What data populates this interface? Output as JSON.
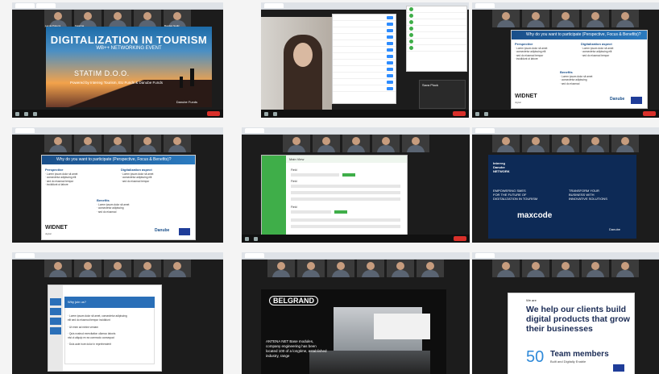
{
  "tile1": {
    "participants": [
      "Lamia Pokorni",
      "Katarina",
      "",
      "",
      "Bogdan Sudić"
    ],
    "slide": {
      "title": "DIGITALIZATION IN TOURISM",
      "subtitle": "WB++ NETWORKING EVENT",
      "company": "STATIM D.O.O.",
      "powered_by": "Powered by Interreg Tourism, EU Funds & Danube Funds",
      "logo": "Danube Funds"
    }
  },
  "tile2": {
    "menu_items": [
      "",
      "",
      "",
      "",
      "",
      "",
      "",
      "",
      "",
      "",
      "",
      ""
    ],
    "chat_items": [
      "",
      "",
      "",
      "",
      "",
      "",
      ""
    ],
    "notification": "Sava Plock"
  },
  "tile3": {
    "slide": {
      "title": "Why do you want to participate (Perspective, Focus & Benefits)?",
      "left_heading": "Perspective",
      "left_lines": [
        "· Lorem ipsum dolor sit amet",
        "· consectetur adipiscing elit",
        "· sed do eiusmod tempor",
        "· incididunt ut labore"
      ],
      "right_heading": "Digitalization aspect",
      "right_lines": [
        "· Lorem ipsum dolor sit amet",
        "· consectetur adipiscing elit",
        "· sed do eiusmod tempor"
      ],
      "benefits_heading": "Benefits",
      "benefits_lines": [
        "· Lorem ipsum dolor sit amet",
        "· consectetur adipiscing",
        "· sed do eiusmod"
      ],
      "brand": "WIDNET",
      "brand_sub": "digital",
      "logo": "Danube"
    }
  },
  "tile4": {
    "slide": {
      "title": "Why do you want to participate (Perspective, Focus & Benefits)?",
      "left_heading": "Perspective",
      "left_lines": [
        "· Lorem ipsum dolor sit amet",
        "· consectetur adipiscing elit",
        "· sed do eiusmod tempor",
        "· incididunt ut labore"
      ],
      "right_heading": "Digitalization aspect",
      "right_lines": [
        "· Lorem ipsum dolor sit amet",
        "· consectetur adipiscing elit",
        "· sed do eiusmod tempor"
      ],
      "benefits_heading": "Benefits",
      "benefits_lines": [
        "· Lorem ipsum dolor sit amet",
        "· consectetur adipiscing",
        "· sed do eiusmod"
      ],
      "brand": "WIDNET",
      "brand_sub": "digital",
      "logo": "Danube"
    }
  },
  "tile5": {
    "app_title": "Main View",
    "labels": [
      "Field",
      "Field",
      "Field",
      "Field",
      "Field",
      "Field"
    ]
  },
  "tile6": {
    "slide": {
      "header": "Interreg\nDanube\nNETWORK",
      "left_lines": [
        "EMPOWERING SMES",
        "FOR THE FUTURE OF",
        "DIGITALIZATION IN TOURISM"
      ],
      "right_lines": [
        "TRANSFORM YOUR",
        "BUSINESS WITH",
        "INNOVATIVE SOLUTIONS"
      ],
      "brand": "maxcode",
      "logo": "Danube"
    }
  },
  "tile7": {
    "slide": {
      "title": "Why join us?",
      "lines": [
        "· Lorem ipsum dolor sit amet, consectetur adipiscing",
        "  elit sed do eiusmod tempor incididunt",
        "· Ut enim ad minim veniam",
        "· Quis nostrud exercitation ullamco laboris",
        "  nisi ut aliquip ex ea commodo consequat",
        "· Duis aute irure dolor in reprehenderit"
      ]
    }
  },
  "tile8": {
    "slide": {
      "brand": "BELGRAND",
      "headline_lines": [
        "ANTENA NET Base modules,",
        "company engineering has been",
        "located 100 of a longtime, established",
        "industry, range"
      ]
    }
  },
  "tile9": {
    "slide": {
      "small": "We are",
      "headline": "We help our clients build digital products that grow their businesses",
      "number": "50",
      "label": "Team members",
      "label_sub": "Built and Digitally Enable"
    }
  }
}
